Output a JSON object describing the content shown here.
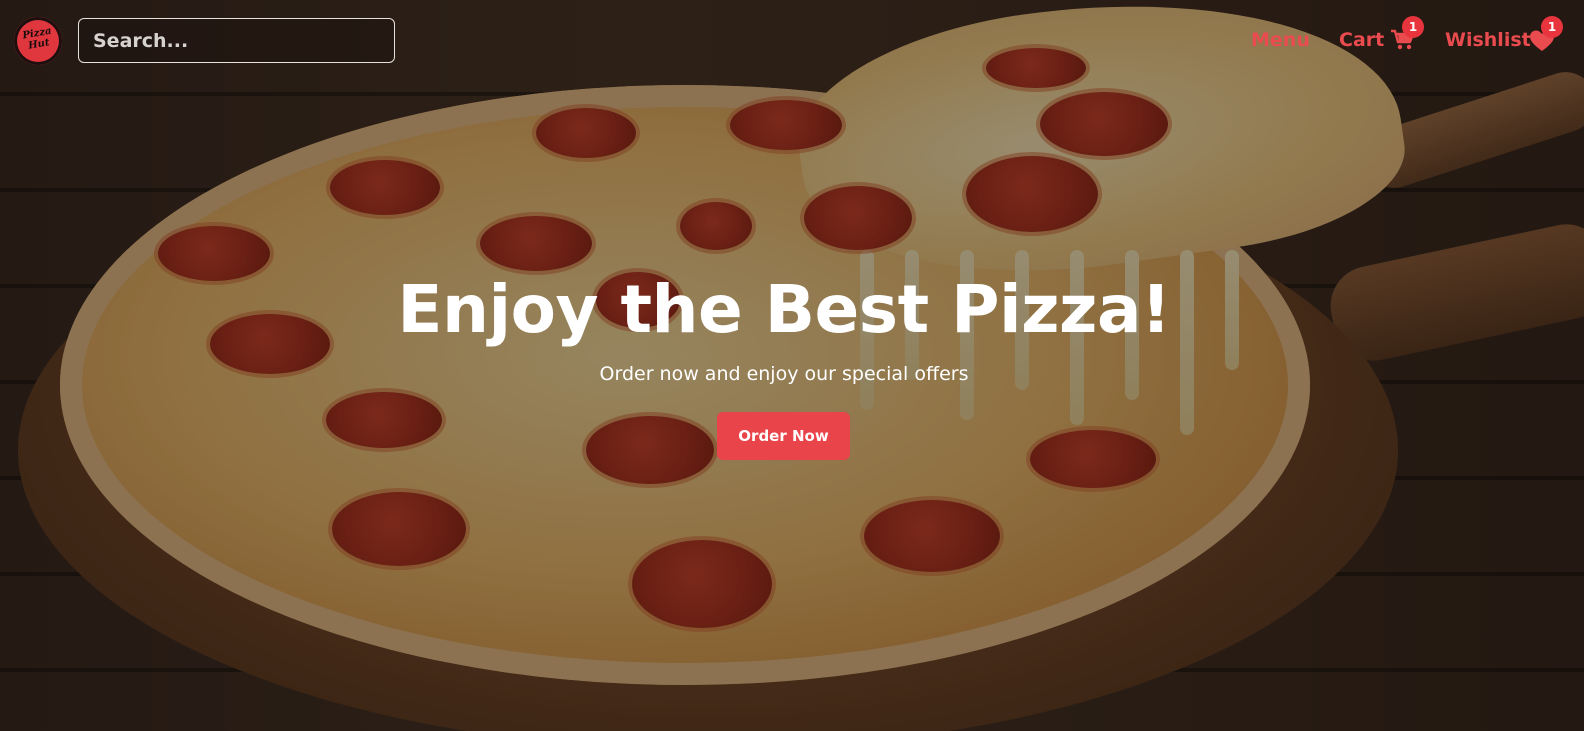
{
  "brand": {
    "logo_text_line1": "Pizza",
    "logo_text_line2": "Hut",
    "accent_color": "#e94b4f"
  },
  "search": {
    "placeholder": "Search..."
  },
  "nav": {
    "menu_label": "Menu",
    "cart_label": "Cart",
    "cart_icon": "shopping-cart-icon",
    "cart_count": "1",
    "wishlist_label": "Wishlist",
    "wishlist_icon": "heart-icon",
    "wishlist_count": "1"
  },
  "hero": {
    "title": "Enjoy the Best Pizza!",
    "subtitle": "Order now and enjoy our special offers",
    "cta_label": "Order Now",
    "cta_color": "#e94449",
    "background_image": "pepperoni-pizza-photo"
  }
}
